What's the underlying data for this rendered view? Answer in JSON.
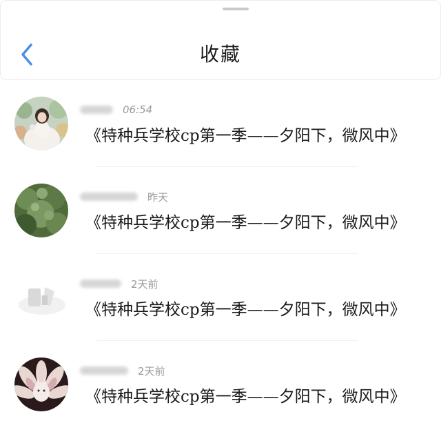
{
  "header": {
    "title": "收藏",
    "back_icon": "chevron-left-icon",
    "accent_color": "#4a90e2"
  },
  "items": [
    {
      "time": "06:54",
      "text": "《特种兵学校cp第一季——夕阳下，微风中》",
      "avatar": "girl-in-white-dress-photo"
    },
    {
      "time": "昨天",
      "text": "《特种兵学校cp第一季——夕阳下，微风中》",
      "avatar": "green-plant-photo"
    },
    {
      "time": "2天前",
      "text": "《特种兵学校cp第一季——夕阳下，微风中》",
      "avatar": "faded-figure-image"
    },
    {
      "time": "2天前",
      "text": "《特种兵学校cp第一季——夕阳下，微风中》",
      "avatar": "nine-tailed-fox-artwork"
    }
  ]
}
